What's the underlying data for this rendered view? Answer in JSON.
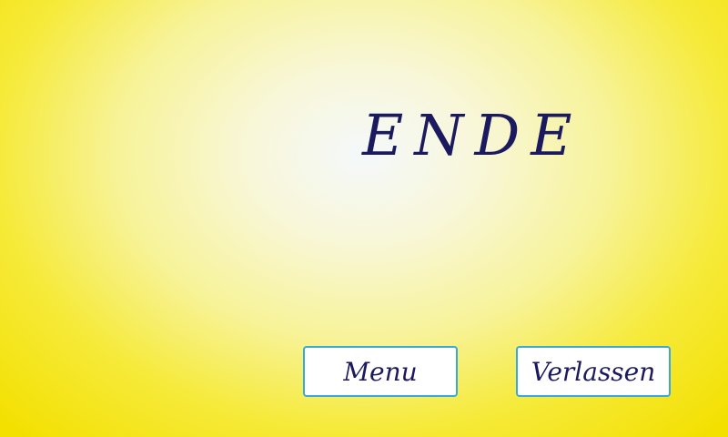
{
  "screen": {
    "title": "ENDE"
  },
  "buttons": {
    "menu_label": "Menu",
    "quit_label": "Verlassen"
  },
  "colors": {
    "text": "#1c1a5e",
    "button_border": "#39a9dd",
    "background_edge": "#f3e000",
    "background_center": "#f4f8fb"
  }
}
